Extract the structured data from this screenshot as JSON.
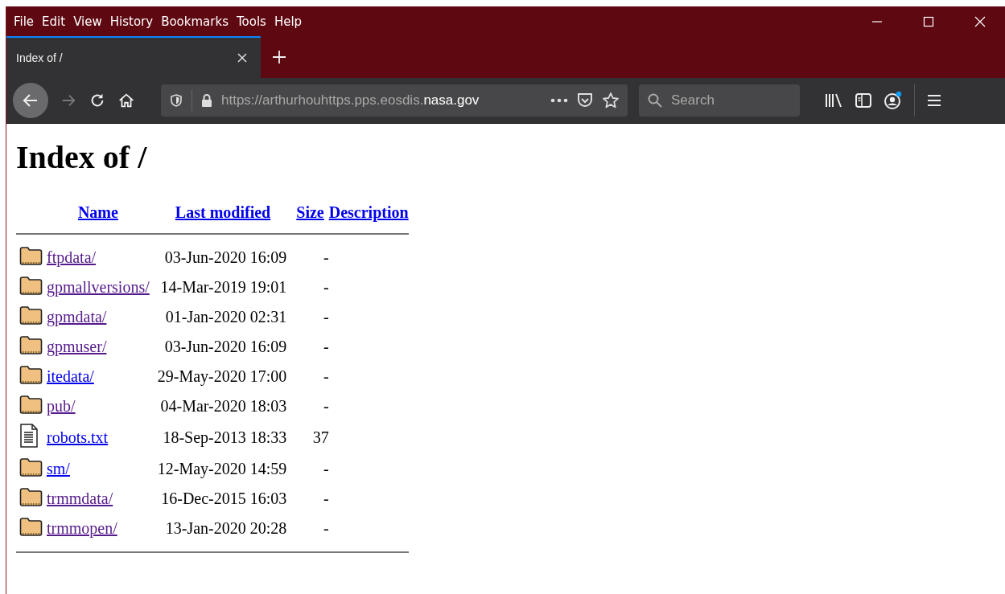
{
  "menu_bar": [
    "File",
    "Edit",
    "View",
    "History",
    "Bookmarks",
    "Tools",
    "Help"
  ],
  "tabs": [
    {
      "title": "Index of /",
      "selected": true
    }
  ],
  "address_bar": {
    "url_start": "https://arthurhouhttps.pps.eosdis.",
    "url_domain": "nasa.gov"
  },
  "search": {
    "placeholder": "Search"
  },
  "page": {
    "heading": "Index of /",
    "columns": [
      "Name",
      "Last modified",
      "Size",
      "Description"
    ],
    "rows": [
      {
        "kind": "folder",
        "name": "ftpdata/",
        "visited": true,
        "modified": "03-Jun-2020 16:09",
        "size": "-"
      },
      {
        "kind": "folder",
        "name": "gpmallversions/",
        "visited": true,
        "modified": "14-Mar-2019 19:01",
        "size": "-"
      },
      {
        "kind": "folder",
        "name": "gpmdata/",
        "visited": true,
        "modified": "01-Jan-2020 02:31",
        "size": "-"
      },
      {
        "kind": "folder",
        "name": "gpmuser/",
        "visited": true,
        "modified": "03-Jun-2020 16:09",
        "size": "-"
      },
      {
        "kind": "folder",
        "name": "itedata/",
        "visited": false,
        "modified": "29-May-2020 17:00",
        "size": "-"
      },
      {
        "kind": "folder",
        "name": "pub/",
        "visited": true,
        "modified": "04-Mar-2020 18:03",
        "size": "-"
      },
      {
        "kind": "file",
        "name": "robots.txt",
        "visited": false,
        "modified": "18-Sep-2013 18:33",
        "size": "37"
      },
      {
        "kind": "folder",
        "name": "sm/",
        "visited": false,
        "modified": "12-May-2020 14:59",
        "size": "-"
      },
      {
        "kind": "folder",
        "name": "trmmdata/",
        "visited": true,
        "modified": "16-Dec-2015 16:03",
        "size": "-"
      },
      {
        "kind": "folder",
        "name": "trmmopen/",
        "visited": true,
        "modified": "13-Jan-2020 20:28",
        "size": "-"
      }
    ]
  }
}
